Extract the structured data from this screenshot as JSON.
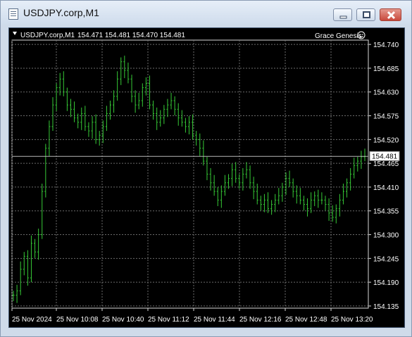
{
  "window": {
    "title": "USDJPY.corp,M1"
  },
  "chart_header": {
    "symbol_text": "USDJPY.corp,M1",
    "ohlc_text": "154.471 154.481 154.470 154.481",
    "account_text": "Grace Genesis"
  },
  "icons": {
    "app": "chart-window-icon",
    "menu": "triangle-down-icon",
    "status": "smiley-icon",
    "minimize": "minimize-icon",
    "maximize": "maximize-icon",
    "close": "close-icon"
  },
  "colors": {
    "background": "#000000",
    "grid": "#6b6b6b",
    "candle": "#36c936",
    "text": "#ffffff",
    "price_line": "#b8b8b8"
  },
  "chart_data": {
    "type": "line",
    "title": "",
    "xlabel": "",
    "ylabel": "",
    "ylim": [
      154.13,
      154.75
    ],
    "yticks": [
      154.74,
      154.685,
      154.63,
      154.575,
      154.52,
      154.465,
      154.41,
      154.355,
      154.3,
      154.245,
      154.19,
      154.135
    ],
    "ytick_labels": [
      "154.740",
      "154.685",
      "154.630",
      "154.575",
      "154.520",
      "154.465",
      "154.410",
      "154.355",
      "154.300",
      "154.245",
      "154.190",
      "154.135"
    ],
    "xtick_labels": [
      "25 Nov 2024",
      "25 Nov 10:08",
      "25 Nov 10:40",
      "25 Nov 11:12",
      "25 Nov 11:44",
      "25 Nov 12:16",
      "25 Nov 12:48",
      "25 Nov 13:20"
    ],
    "current_price": 154.481,
    "current_price_label": "154.481",
    "grid": true,
    "series": [
      {
        "values": [
          154.16,
          154.17,
          154.22,
          154.25,
          154.2,
          154.28,
          154.26,
          154.3,
          154.4,
          154.5,
          154.55,
          154.6,
          154.64,
          154.66,
          154.63,
          154.6,
          154.59,
          154.57,
          154.56,
          154.58,
          154.55,
          154.54,
          154.56,
          154.52,
          154.53,
          154.55,
          154.58,
          154.6,
          154.62,
          154.66,
          154.7,
          154.68,
          154.66,
          154.62,
          154.6,
          154.61,
          154.64,
          154.65,
          154.6,
          154.58,
          154.56,
          154.57,
          154.59,
          154.6,
          154.61,
          154.59,
          154.57,
          154.56,
          154.55,
          154.56,
          154.53,
          154.52,
          154.5,
          154.47,
          154.44,
          154.42,
          154.4,
          154.38,
          154.4,
          154.42,
          154.43,
          154.45,
          154.43,
          154.42,
          154.44,
          154.45,
          154.42,
          154.4,
          154.38,
          154.37,
          154.38,
          154.36,
          154.37,
          154.38,
          154.39,
          154.41,
          154.43,
          154.42,
          154.4,
          154.39,
          154.38,
          154.37,
          154.36,
          154.38,
          154.39,
          154.38,
          154.38,
          154.37,
          154.35,
          154.34,
          154.36,
          154.38,
          154.4,
          154.42,
          154.44,
          154.46,
          154.47,
          154.48,
          154.481
        ]
      }
    ]
  }
}
